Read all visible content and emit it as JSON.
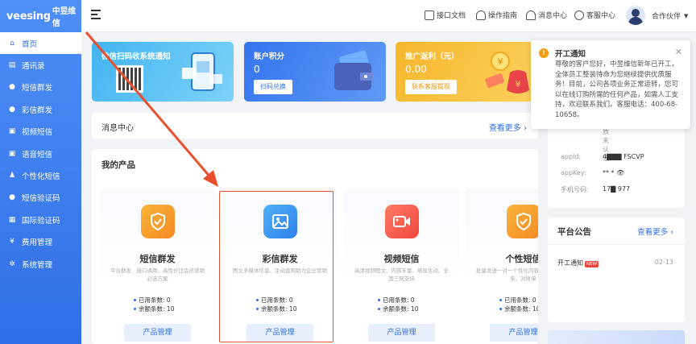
{
  "brand": {
    "logo_text": "veesing",
    "logo_cn": "中昱维信"
  },
  "sidebar": {
    "items": [
      {
        "label": "首页",
        "icon": "home-icon"
      },
      {
        "label": "通讯录",
        "icon": "contacts-icon"
      },
      {
        "label": "短信群发",
        "icon": "sms-icon"
      },
      {
        "label": "彩信群发",
        "icon": "mms-icon"
      },
      {
        "label": "视频短信",
        "icon": "video-sms-icon"
      },
      {
        "label": "语音短信",
        "icon": "voice-sms-icon"
      },
      {
        "label": "个性化短信",
        "icon": "personalized-sms-icon"
      },
      {
        "label": "短信验证码",
        "icon": "verification-code-icon"
      },
      {
        "label": "国际验证码",
        "icon": "international-code-icon"
      },
      {
        "label": "费用管理",
        "icon": "billing-icon"
      },
      {
        "label": "系统管理",
        "icon": "settings-icon"
      }
    ]
  },
  "header": {
    "links": [
      "接口文档",
      "操作指南",
      "消息中心",
      "客服中心"
    ],
    "user": "合作伙伴"
  },
  "banners": {
    "wechat": {
      "title": "微信扫码收系统通知"
    },
    "points": {
      "title": "账户积分",
      "value": "0",
      "button": "扫码兑换"
    },
    "rebate": {
      "title": "推广返利（元）",
      "value": "0.00",
      "button": "联系客服提现"
    }
  },
  "message_center": {
    "title": "消息中心",
    "more": "查看更多"
  },
  "products": {
    "title": "我的产品",
    "items": [
      {
        "name": "短信群发",
        "desc": "平台群发、接口调用、高性价比会员营销必选方案",
        "used_label": "已用条数:",
        "used": "0",
        "remain_label": "余额条数:",
        "remain": "10",
        "button": "产品管理"
      },
      {
        "name": "彩信群发",
        "desc": "图文多媒体信息、生动直观助力企业营销",
        "used_label": "已用条数:",
        "used": "0",
        "remain_label": "余额条数:",
        "remain": "10",
        "button": "产品管理"
      },
      {
        "name": "视频短信",
        "desc": "高清视频图文、内容丰富、展现生动、全国三网支持",
        "used_label": "已用条数:",
        "used": "0",
        "remain_label": "余额条数:",
        "remain": "10",
        "button": "产品管理"
      },
      {
        "name": "个性短信",
        "desc": "批量发送一对一个性化内容，适用于工资条、对账单",
        "used_label": "已用条数:",
        "used": "0",
        "remain_label": "余额条数:",
        "remain": "10",
        "button": "产品管理"
      }
    ]
  },
  "account": {
    "cert": "质未认证",
    "appid_label": "appId:",
    "appid": "4▇▇▇  FSCVP",
    "appkey_label": "appKey:",
    "appkey": "**        * 👁",
    "phone_label": "手机号码:",
    "phone": "17▇    977"
  },
  "announcements": {
    "title": "平台公告",
    "more": "查看更多",
    "items": [
      {
        "title": "开工通知",
        "badge": "NEW",
        "date": "02-13"
      }
    ]
  },
  "popup": {
    "title": "开工通知",
    "body": "尊敬的客户您好，中昱维信新年已开工，全体员工整装待命为您继续提供优质服务！目前，公司各项业务正常运转，您可以在线订购所需的任何产品，如需人工支持，欢迎联系我们。客服电话：400-68-10658。"
  },
  "colors": {
    "primary": "#2f6fe6",
    "annotation": "#e8502e",
    "warning": "#f39c12"
  }
}
